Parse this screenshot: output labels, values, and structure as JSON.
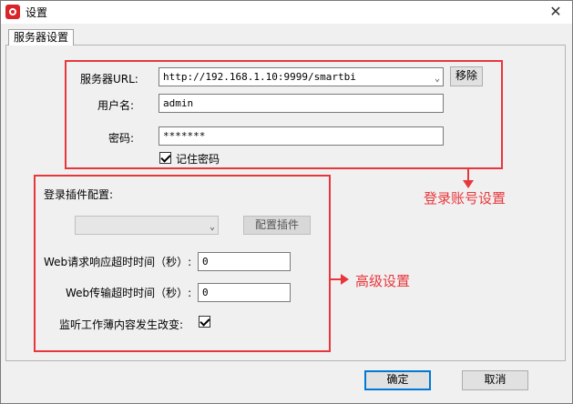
{
  "window": {
    "title": "设置",
    "close_glyph": "✕",
    "icon": "app-logo-icon"
  },
  "tab": {
    "label": "服务器设置"
  },
  "server": {
    "url_label": "服务器URL:",
    "url_value": "http://192.168.1.10:9999/smartbi",
    "remove_label": "移除",
    "username_label": "用户名:",
    "username_value": "admin",
    "password_label": "密码:",
    "password_value": "*******",
    "remember_label": "记住密码",
    "remember_checked": true
  },
  "advanced": {
    "plugin_label": "登录插件配置:",
    "plugin_select_value": "",
    "config_plugin_label": "配置插件",
    "web_response_label": "Web请求响应超时时间（秒）:",
    "web_response_value": "0",
    "web_transfer_label": "Web传输超时时间（秒）:",
    "web_transfer_value": "0",
    "monitor_label": "监听工作薄内容发生改变:",
    "monitor_checked": true
  },
  "annotations": {
    "login_account": "登录账号设置",
    "advanced": "高级设置",
    "color": "#e8373c"
  },
  "footer": {
    "ok_label": "确定",
    "cancel_label": "取消"
  }
}
